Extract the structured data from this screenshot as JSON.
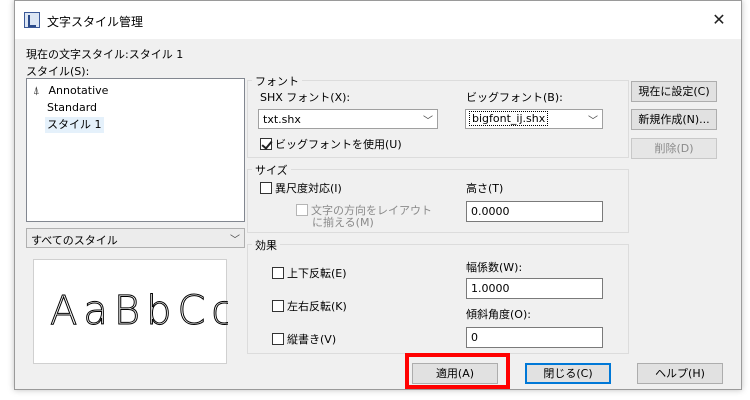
{
  "window": {
    "title": "文字スタイル管理"
  },
  "current_style_text": "現在の文字スタイル:スタイル 1",
  "styles_label": "スタイル(S):",
  "styles": [
    {
      "label": "Annotative",
      "icon": "annotative-icon"
    },
    {
      "label": "Standard"
    },
    {
      "label": "スタイル 1",
      "selected": true
    }
  ],
  "style_filter": {
    "value": "すべてのスタイル"
  },
  "preview_text": "AaBbCc",
  "font": {
    "group_title": "フォント",
    "shx_label": "SHX フォント(X):",
    "shx_value": "txt.shx",
    "big_label": "ビッグフォント(B):",
    "big_value": "bigfont_ij.shx",
    "use_big_label": "ビッグフォントを使用(U)",
    "use_big_checked": true
  },
  "size": {
    "group_title": "サイズ",
    "annotative_label": "異尺度対応(I)",
    "match_layout_line1": "文字の方向をレイアウト",
    "match_layout_line2": "に揃える(M)",
    "height_label": "高さ(T)",
    "height_value": "0.0000"
  },
  "effects": {
    "group_title": "効果",
    "upside_down_label": "上下反転(E)",
    "backwards_label": "左右反転(K)",
    "vertical_label": "縦書き(V)",
    "width_label": "幅係数(W):",
    "width_value": "1.0000",
    "oblique_label": "傾斜角度(O):",
    "oblique_value": "0"
  },
  "buttons": {
    "set_current": "現在に設定(C)",
    "new": "新規作成(N)...",
    "delete": "削除(D)",
    "apply": "適用(A)",
    "close": "閉じる(C)",
    "help": "ヘルプ(H)"
  },
  "colors": {
    "highlight": "#ff0000",
    "focus": "#0078d7"
  }
}
